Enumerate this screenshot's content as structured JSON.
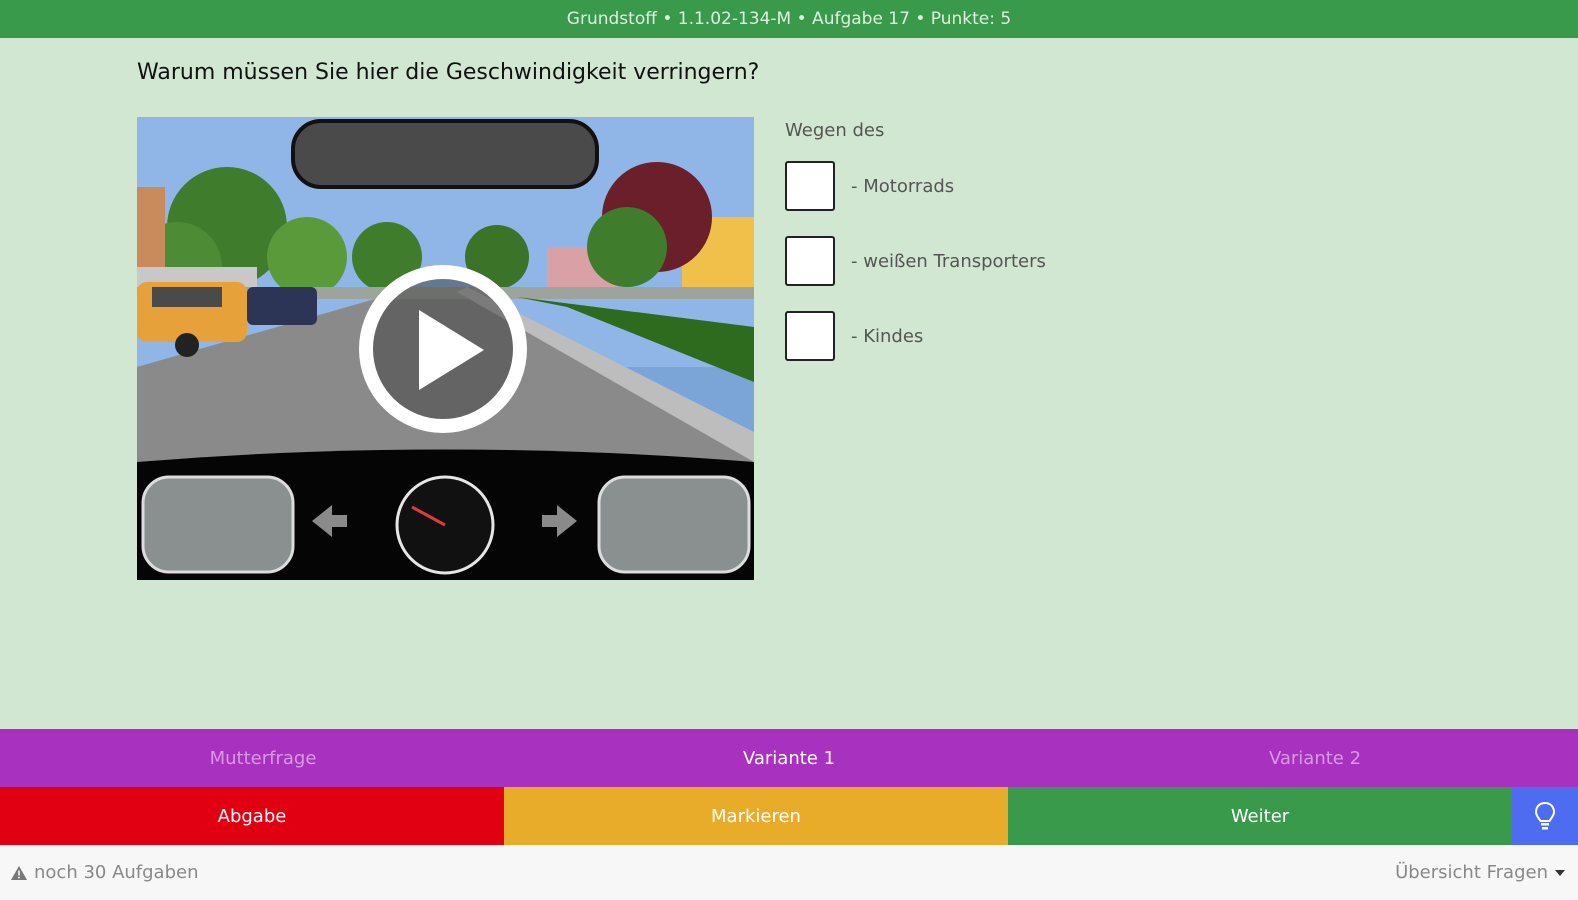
{
  "header": {
    "title": "Grundstoff • 1.1.02-134-M • Aufgabe 17 • Punkte: 5"
  },
  "question": {
    "text": "Warum müssen Sie hier die Geschwindigkeit verringern?"
  },
  "answers": {
    "label": "Wegen des",
    "options": [
      {
        "text": "- Motorrads"
      },
      {
        "text": "- weißen Transporters"
      },
      {
        "text": "- Kindes"
      }
    ]
  },
  "variants": {
    "items": [
      "Mutterfrage",
      "Variante 1",
      "Variante 2"
    ],
    "active": "Variante 1"
  },
  "actions": {
    "submit": "Abgabe",
    "mark": "Markieren",
    "next": "Weiter"
  },
  "footer": {
    "remaining": "noch 30 Aufgaben",
    "overview": "Übersicht Fragen"
  },
  "colors": {
    "header": "#3a9a4c",
    "variants": "#a931bf",
    "submit": "#e10012",
    "mark": "#e8ac2a",
    "next": "#3a9a4c",
    "hint": "#4d6cf0"
  },
  "icons": {
    "play": "play-icon",
    "hint": "lightbulb-icon",
    "warning": "warning-icon",
    "dropdown": "caret-down-icon"
  }
}
